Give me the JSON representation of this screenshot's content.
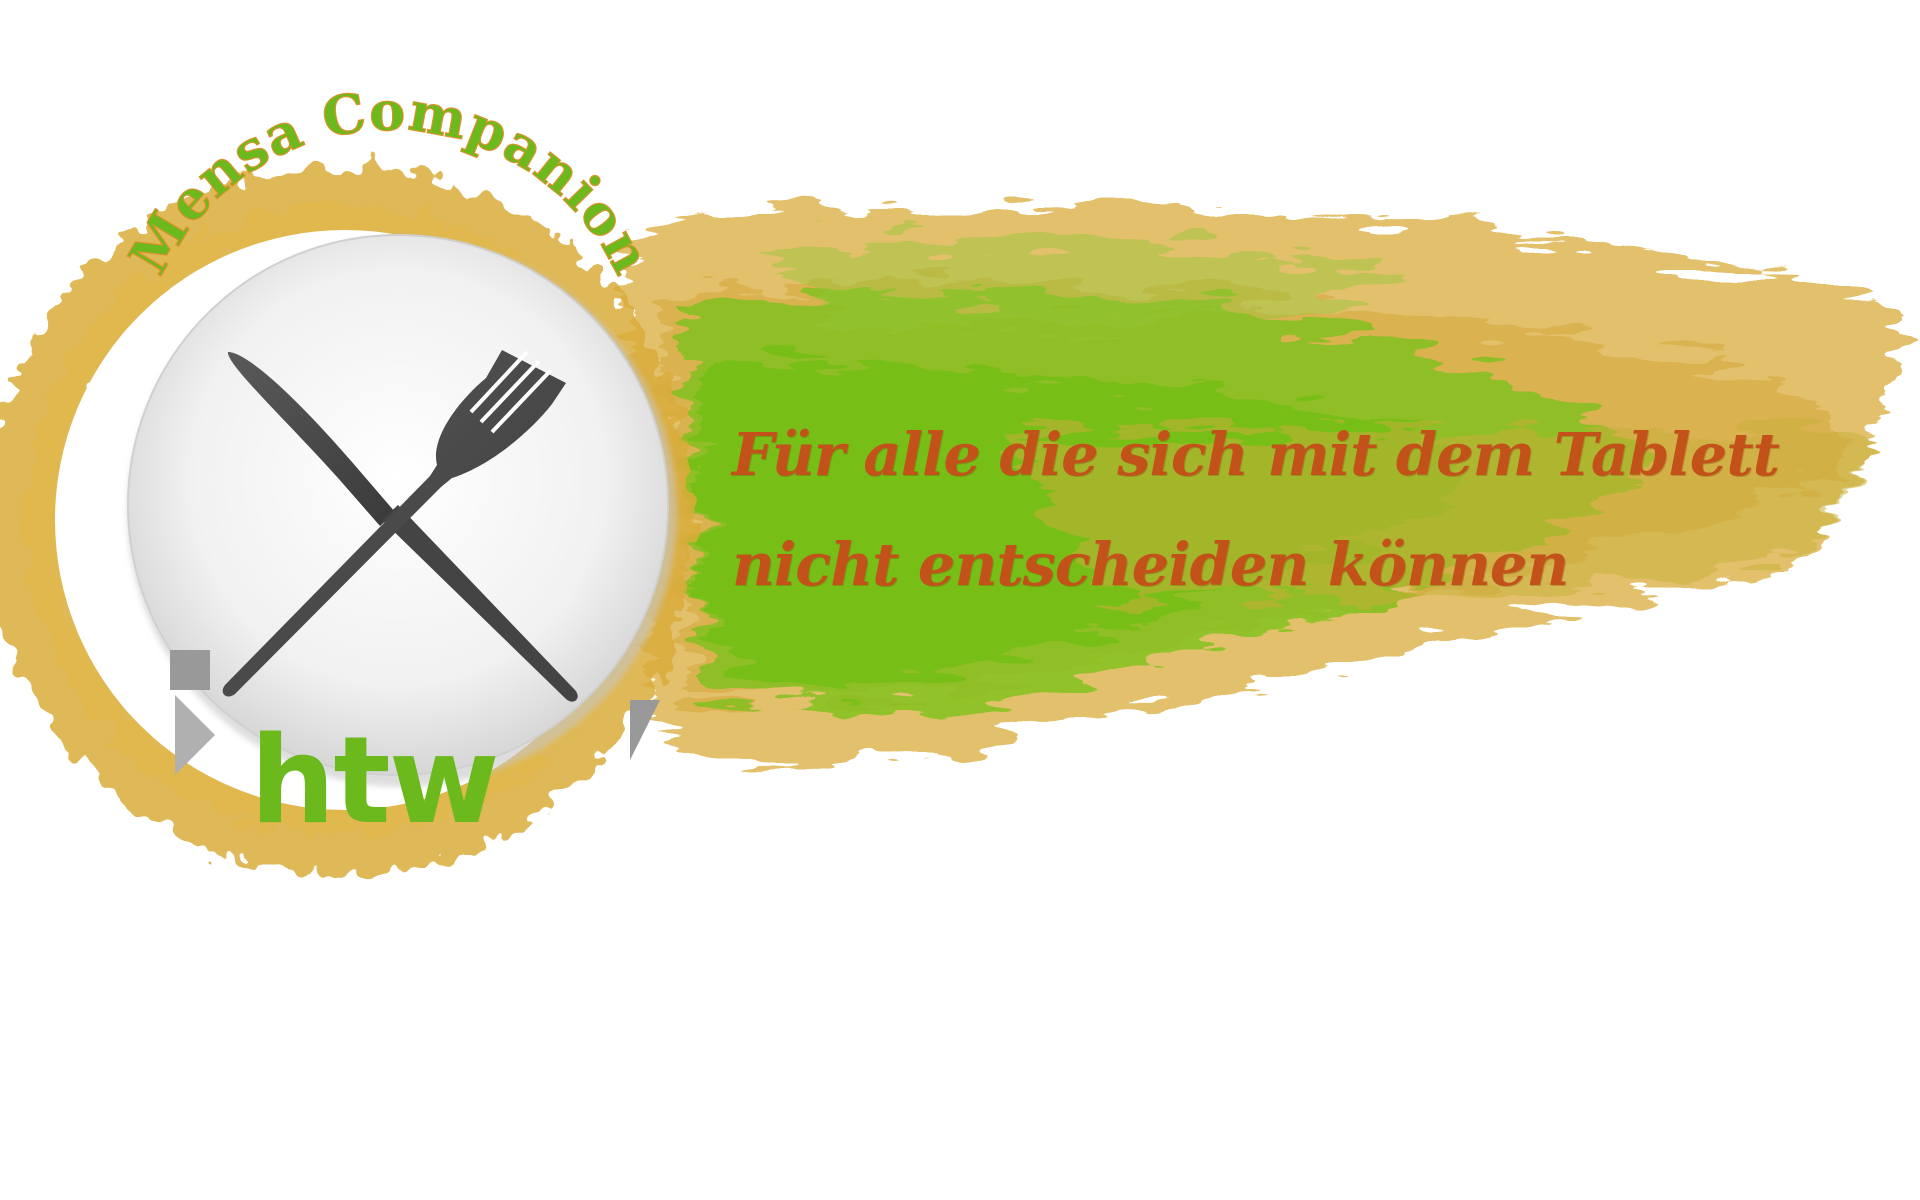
{
  "logo": {
    "name": "Mensa Companion",
    "institution_mark": "htw"
  },
  "tagline": {
    "line1": "Für alle die sich mit dem Tablett",
    "line2": "nicht entscheiden können"
  },
  "colors": {
    "accent_orange": "#c2521a",
    "paint_green": "#7cc21a",
    "paint_ochre": "#d9ab3a",
    "logo_green": "#6cb91e",
    "logo_gray": "#999999"
  },
  "icons": {
    "plate": "plate-icon",
    "knife": "knife-icon",
    "fork": "fork-icon"
  }
}
